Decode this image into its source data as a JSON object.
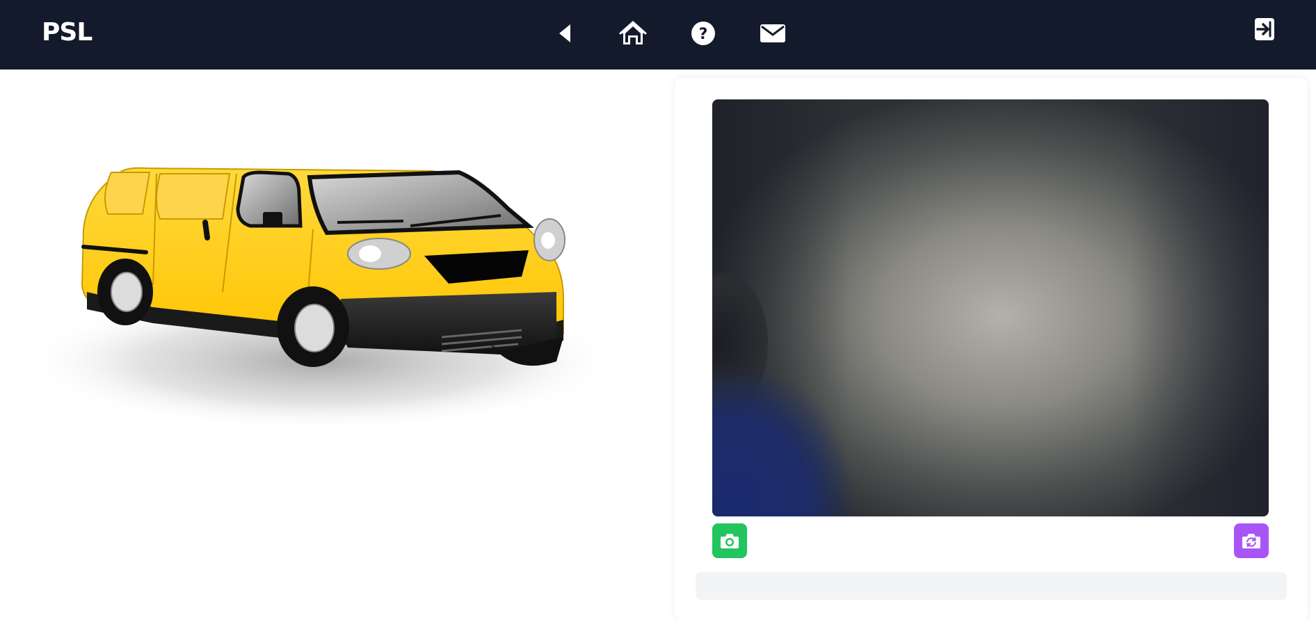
{
  "header": {
    "brand": "PSL",
    "nav": {
      "back_icon": "triangle-left-icon",
      "home_icon": "home-icon",
      "help_icon": "question-circle-icon",
      "mail_icon": "envelope-icon",
      "logout_icon": "logout-arrow-icon"
    }
  },
  "illustration": {
    "subject": "yellow-van"
  },
  "camera": {
    "capture_icon": "camera-icon",
    "switch_icon": "camera-switch-icon",
    "result_text": ""
  },
  "colors": {
    "navbar": "#131a2b",
    "capture_button": "#22c55e",
    "switch_button": "#a855f7",
    "result_bar": "#f3f4f6",
    "van_body": "#ffc800"
  }
}
